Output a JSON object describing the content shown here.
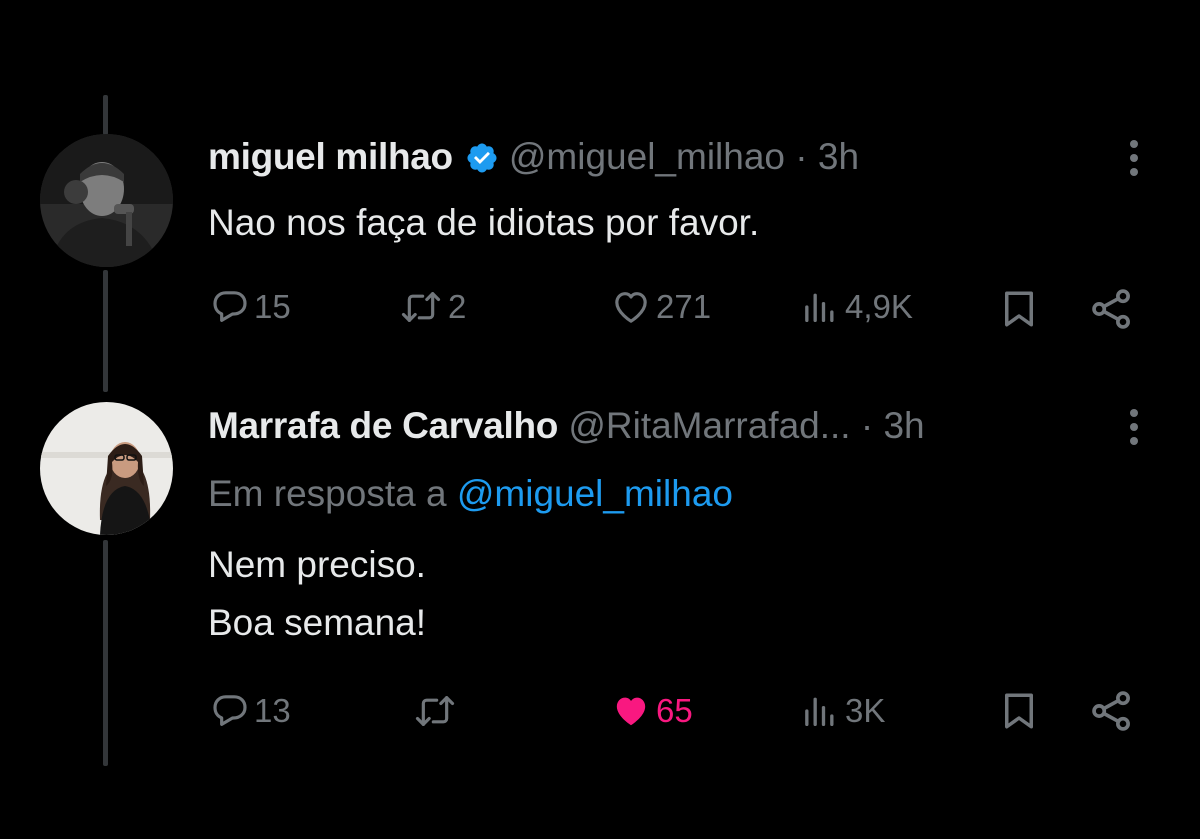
{
  "tweets": [
    {
      "author_name": "miguel milhao",
      "verified": true,
      "handle": "@miguel_milhao",
      "separator": "·",
      "time": "3h",
      "reply_prefix": "",
      "reply_mention": "",
      "text_lines": [
        "Nao nos faça de idiotas por favor."
      ],
      "actions": {
        "replies": "15",
        "retweets": "2",
        "likes": "271",
        "views": "4,9K",
        "liked": false
      }
    },
    {
      "author_name": "Marrafa de Carvalho",
      "verified": false,
      "handle": "@RitaMarrafad...",
      "separator": "·",
      "time": "3h",
      "reply_prefix": "Em resposta a",
      "reply_mention": "@miguel_milhao",
      "text_lines": [
        "Nem preciso.",
        "Boa semana!"
      ],
      "actions": {
        "replies": "13",
        "retweets": "",
        "likes": "65",
        "views": "3K",
        "liked": true
      }
    }
  ],
  "icons": {
    "reply": "reply-bubble-icon",
    "retweet": "retweet-icon",
    "like": "heart-icon",
    "views": "views-bar-chart-icon",
    "bookmark": "bookmark-icon",
    "share": "share-icon",
    "more": "more-vertical-icon",
    "verified": "verified-badge-icon"
  },
  "colors": {
    "background": "#000000",
    "text": "#e7e9ea",
    "muted": "#71767b",
    "link": "#1d9bf0",
    "like_active": "#f91880",
    "thread_line": "#333639"
  }
}
